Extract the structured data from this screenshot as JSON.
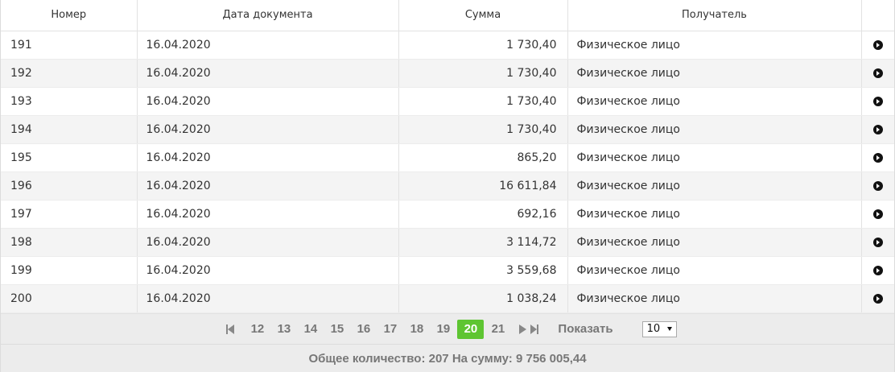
{
  "table": {
    "headers": [
      "Номер",
      "Дата документа",
      "Сумма",
      "Получатель",
      ""
    ],
    "rows": [
      {
        "number": "191",
        "date": "16.04.2020",
        "sum": "1 730,40",
        "recipient": "Физическое лицо"
      },
      {
        "number": "192",
        "date": "16.04.2020",
        "sum": "1 730,40",
        "recipient": "Физическое лицо"
      },
      {
        "number": "193",
        "date": "16.04.2020",
        "sum": "1 730,40",
        "recipient": "Физическое лицо"
      },
      {
        "number": "194",
        "date": "16.04.2020",
        "sum": "1 730,40",
        "recipient": "Физическое лицо"
      },
      {
        "number": "195",
        "date": "16.04.2020",
        "sum": "865,20",
        "recipient": "Физическое лицо"
      },
      {
        "number": "196",
        "date": "16.04.2020",
        "sum": "16 611,84",
        "recipient": "Физическое лицо"
      },
      {
        "number": "197",
        "date": "16.04.2020",
        "sum": "692,16",
        "recipient": "Физическое лицо"
      },
      {
        "number": "198",
        "date": "16.04.2020",
        "sum": "3 114,72",
        "recipient": "Физическое лицо"
      },
      {
        "number": "199",
        "date": "16.04.2020",
        "sum": "3 559,68",
        "recipient": "Физическое лицо"
      },
      {
        "number": "200",
        "date": "16.04.2020",
        "sum": "1 038,24",
        "recipient": "Физическое лицо"
      }
    ],
    "row_action_icon": "circle-arrow-right-icon"
  },
  "pagination": {
    "first_icon": "first-page-icon",
    "pages": [
      "12",
      "13",
      "14",
      "15",
      "16",
      "17",
      "18",
      "19",
      "20",
      "21"
    ],
    "active_page": "20",
    "next_icon": "next-page-icon",
    "last_icon": "last-page-icon",
    "show_label": "Показать",
    "per_page_value": "10",
    "active_color": "#5ec532"
  },
  "totals": {
    "count_label": "Общее количество:",
    "count_value": "207",
    "sum_label": "На сумму:",
    "sum_value": "9 756 005,44"
  }
}
